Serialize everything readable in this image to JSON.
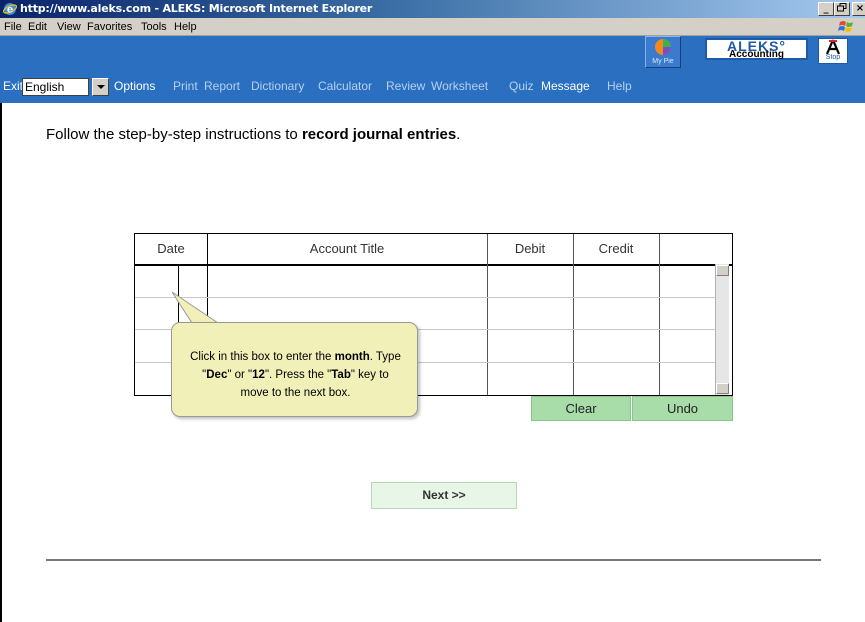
{
  "window": {
    "title": "http://www.aleks.com - ALEKS: Microsoft Internet Explorer",
    "min_label": "_",
    "max_label": " ",
    "close_label": "×"
  },
  "menubar": {
    "items": [
      "File",
      "Edit",
      "View",
      "Favorites",
      "Tools",
      "Help"
    ]
  },
  "nav": {
    "exit": "Exit",
    "language": "English",
    "links": [
      "Options",
      "Print",
      "Report",
      "Dictionary",
      "Calculator",
      "Review",
      "Worksheet",
      "Quiz",
      "Message",
      "Help"
    ],
    "mypie_label": "My Pie",
    "logo_name": "ALEKS°",
    "logo_sub": "Accounting",
    "stop_label": "Stop"
  },
  "instruction": {
    "prefix": "Follow the step-by-step instructions to ",
    "emphasis": "record journal entries",
    "suffix": "."
  },
  "journal": {
    "columns": [
      "Date",
      "Account Title",
      "Debit",
      "Credit"
    ],
    "rows": 4
  },
  "buttons": {
    "clear": "Clear",
    "undo": "Undo",
    "next": "Next >>"
  },
  "tooltip": {
    "line1_a": "Click in this box to enter the ",
    "line1_b": "month",
    "line1_c": ". Type",
    "line2_a": "\"",
    "line2_b": "Dec",
    "line2_c": "\" or \"",
    "line2_d": "12",
    "line2_e": "\". Press the \"",
    "line2_f": "Tab",
    "line2_g": "\" key to",
    "line3": "move to the next box."
  },
  "colors": {
    "nav_bg": "#2a6fc0",
    "button_green": "#a8dca8",
    "tooltip_bg": "#f1f0b8"
  }
}
